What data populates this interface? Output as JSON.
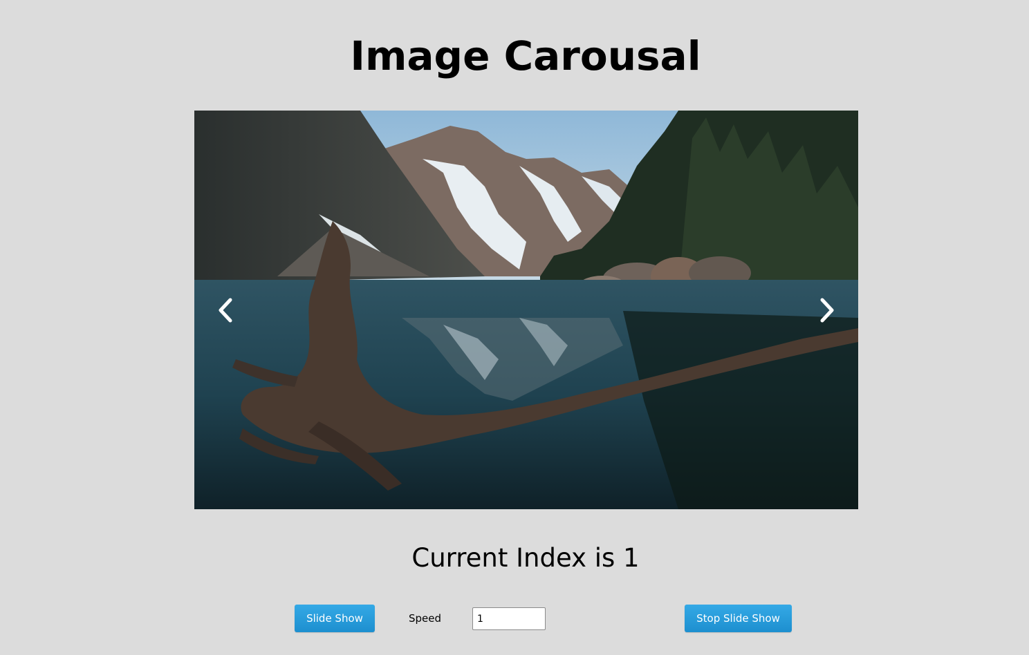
{
  "header": {
    "title": "Image Carousal"
  },
  "carousel": {
    "image_description_icon": "mountain-lake-photo",
    "prev_icon": "chevron-left-icon",
    "next_icon": "chevron-right-icon"
  },
  "status": {
    "current_index_text": "Current Index is 1"
  },
  "controls": {
    "slide_show_label": "Slide Show",
    "speed_label": "Speed",
    "speed_value": "1",
    "stop_slide_show_label": "Stop Slide Show"
  },
  "colors": {
    "background": "#dcdcdc",
    "button": "#2a9fdd",
    "button_text": "#ffffff"
  }
}
